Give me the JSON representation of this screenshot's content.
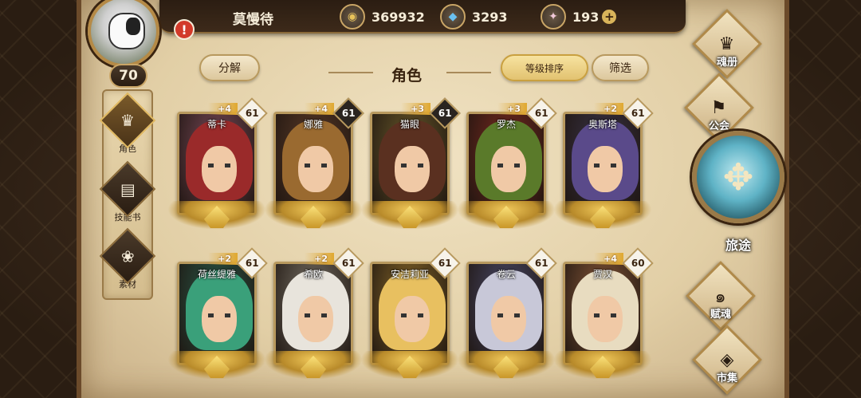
{
  "player": {
    "name": "莫慢待",
    "level": "70",
    "alert": "!"
  },
  "resources": [
    {
      "icon": "gold-coin-icon",
      "glyph": "◉",
      "value": "369932"
    },
    {
      "icon": "blue-crystal-icon",
      "glyph": "◆",
      "value": "3293"
    },
    {
      "icon": "pink-gem-icon",
      "glyph": "✦",
      "value": "193",
      "plus": "+"
    }
  ],
  "sidebar": {
    "items": [
      {
        "label": "角色",
        "glyph": "♛",
        "active": true
      },
      {
        "label": "技能书",
        "glyph": "▤",
        "active": false
      },
      {
        "label": "素材",
        "glyph": "❀",
        "active": false
      }
    ]
  },
  "header": {
    "decompose": "分解",
    "title": "角色",
    "sort": "等级排序",
    "filter": "筛选"
  },
  "heroes": [
    {
      "name": "蒂卡",
      "star": "+4",
      "level": "61",
      "dark": false,
      "hair": "#9a2a2a",
      "bg": "#7a4a5a"
    },
    {
      "name": "娜雅",
      "star": "+4",
      "level": "61",
      "dark": true,
      "hair": "#9a6a30",
      "bg": "#5a3a28"
    },
    {
      "name": "猫眼",
      "star": "+3",
      "level": "61",
      "dark": true,
      "hair": "#5a3020",
      "bg": "#6a5a2a"
    },
    {
      "name": "罗杰",
      "star": "+3",
      "level": "61",
      "dark": false,
      "hair": "#5a7a2a",
      "bg": "#7a2a20"
    },
    {
      "name": "奥斯塔",
      "star": "+2",
      "level": "61",
      "dark": false,
      "hair": "#5a4a8a",
      "bg": "#3a3448"
    },
    {
      "name": "荷丝缇雅",
      "star": "+2",
      "level": "61",
      "dark": false,
      "hair": "#3aa07a",
      "bg": "#2a5a4a"
    },
    {
      "name": "希欧",
      "star": "+2",
      "level": "61",
      "dark": false,
      "hair": "#e8e4dc",
      "bg": "#7a7468"
    },
    {
      "name": "安洁莉亚",
      "star": "",
      "level": "61",
      "dark": false,
      "hair": "#e8c060",
      "bg": "#8a6a2a"
    },
    {
      "name": "卷云",
      "star": "",
      "level": "61",
      "dark": false,
      "hair": "#c8c8d8",
      "bg": "#4a4a6a"
    },
    {
      "name": "贾汉",
      "star": "+4",
      "level": "60",
      "dark": false,
      "hair": "#e8dcc0",
      "bg": "#8a5a3a"
    }
  ],
  "right_menu": {
    "soul_book": "魂册",
    "guild": "公会",
    "journey": "旅途",
    "talent": "赋魂",
    "market": "市集"
  }
}
